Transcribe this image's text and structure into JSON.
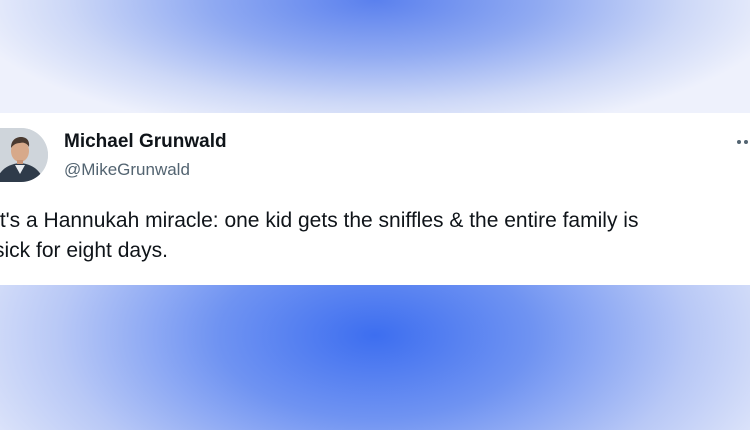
{
  "tweet": {
    "author_name": "Michael Grunwald",
    "author_handle": "@MikeGrunwald",
    "text_lines": [
      "It's a Hannukah miracle: one kid gets the sniffles & the entire family is",
      "sick for eight days."
    ],
    "avatar_icon": "profile-photo",
    "more_icon": "more-options-icon"
  },
  "colors": {
    "card": "#ffffff",
    "name": "#0f1419",
    "handle": "#536471",
    "background_center": "#3d6ef0"
  }
}
